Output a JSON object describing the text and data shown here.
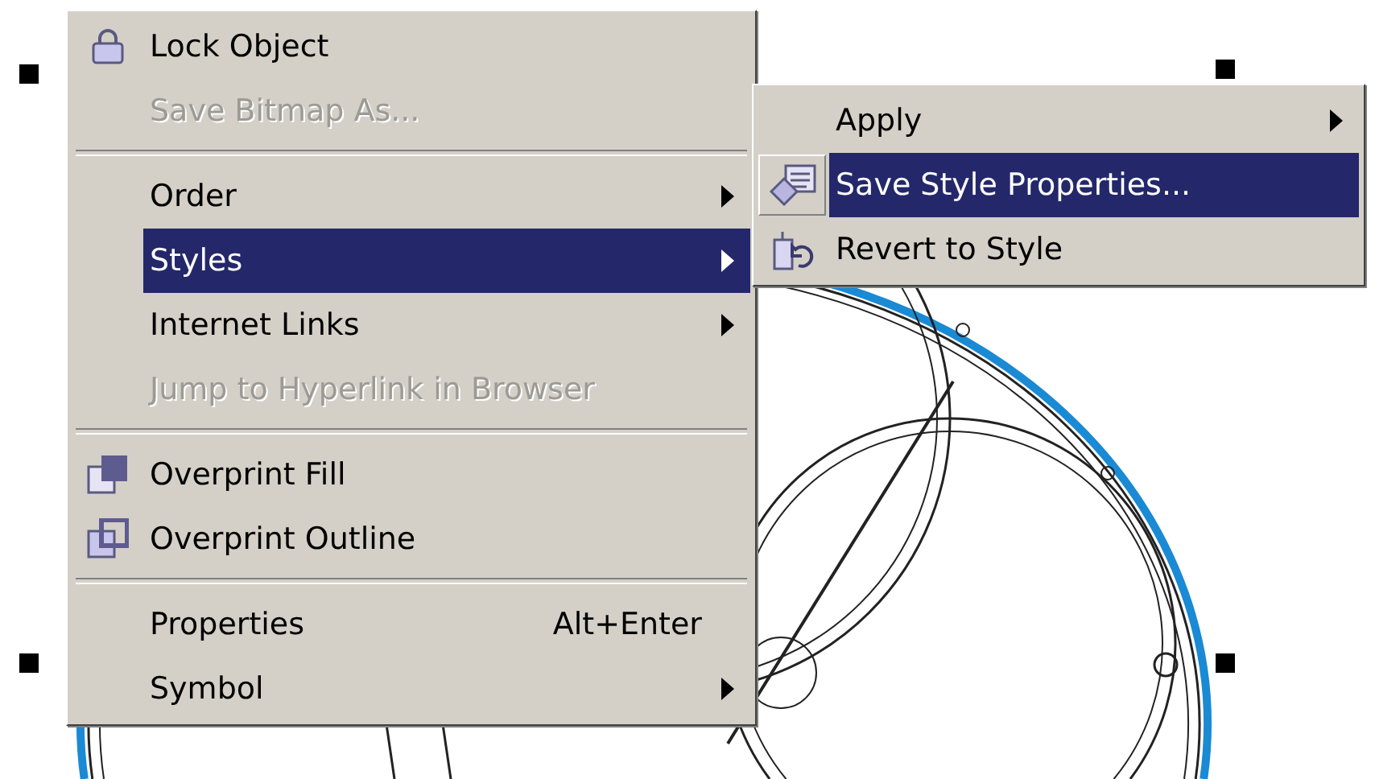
{
  "context_menu": {
    "items": [
      {
        "kind": "command",
        "label": "Lock Object",
        "disabled": false,
        "selected": false
      },
      {
        "kind": "command",
        "label": "Save Bitmap As...",
        "disabled": true,
        "selected": false
      },
      {
        "kind": "separator"
      },
      {
        "kind": "submenu",
        "label": "Order",
        "disabled": false,
        "selected": false
      },
      {
        "kind": "submenu",
        "label": "Styles",
        "disabled": false,
        "selected": true
      },
      {
        "kind": "submenu",
        "label": "Internet Links",
        "disabled": false,
        "selected": false
      },
      {
        "kind": "command",
        "label": "Jump to Hyperlink in Browser",
        "disabled": true,
        "selected": false
      },
      {
        "kind": "separator"
      },
      {
        "kind": "command",
        "label": "Overprint Fill",
        "disabled": false,
        "selected": false
      },
      {
        "kind": "command",
        "label": "Overprint Outline",
        "disabled": false,
        "selected": false
      },
      {
        "kind": "separator"
      },
      {
        "kind": "command",
        "label": "Properties",
        "shortcut": "Alt+Enter",
        "disabled": false,
        "selected": false
      },
      {
        "kind": "submenu",
        "label": "Symbol",
        "disabled": false,
        "selected": false
      }
    ]
  },
  "submenu": {
    "items": [
      {
        "kind": "submenu",
        "label": "Apply",
        "disabled": false,
        "selected": false
      },
      {
        "kind": "command",
        "label": "Save Style Properties...",
        "disabled": false,
        "selected": true
      },
      {
        "kind": "command",
        "label": "Revert to Style",
        "disabled": false,
        "selected": false
      }
    ]
  }
}
